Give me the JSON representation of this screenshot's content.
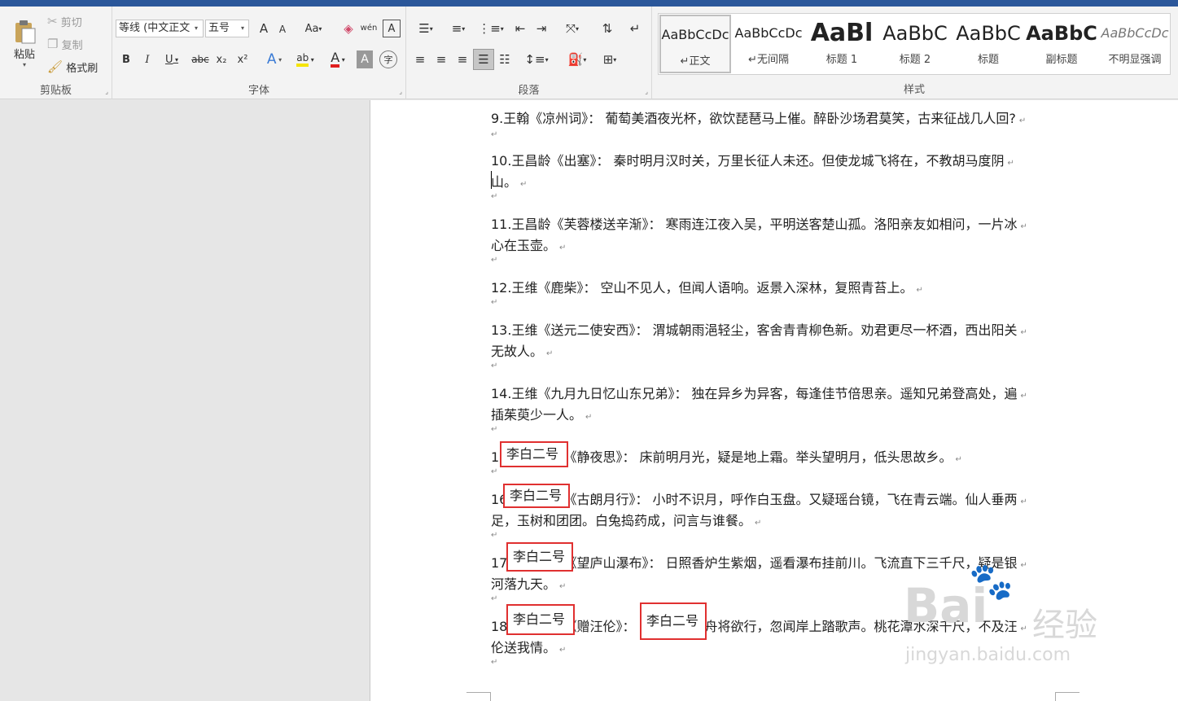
{
  "clipboard": {
    "paste": "粘贴",
    "cut": "剪切",
    "copy": "复制",
    "format_painter": "格式刷",
    "group": "剪贴板"
  },
  "font": {
    "name": "等线 (中文正文",
    "size": "五号",
    "group": "字体",
    "bold": "B",
    "italic": "I",
    "underline": "U",
    "strike": "abc",
    "sub": "x₂",
    "sup": "x²",
    "case": "Aa",
    "grow": "A",
    "shrink": "A",
    "phonetic": "wén",
    "border_char": "A",
    "text_effect": "A",
    "highlight": "ab",
    "color": "A",
    "shade": "A",
    "enclose": "字"
  },
  "paragraph": {
    "group": "段落"
  },
  "styles": {
    "group": "样式",
    "items": [
      {
        "preview": "AaBbCcDc",
        "name": "↵正文",
        "selected": true
      },
      {
        "preview": "AaBbCcDc",
        "name": "↵无间隔"
      },
      {
        "preview": "AaBl",
        "name": "标题 1"
      },
      {
        "preview": "AaBbC",
        "name": "标题 2"
      },
      {
        "preview": "AaBbC",
        "name": "标题"
      },
      {
        "preview": "AaBbC",
        "name": "副标题"
      },
      {
        "preview": "AaBbCcDc",
        "name": "不明显强调"
      }
    ]
  },
  "document": {
    "lines": [
      "9.王翰《凉州词》： 葡萄美酒夜光杯，欲饮琵琶马上催。醉卧沙场君莫笑，古来征战几人回?",
      "10.王昌龄《出塞》： 秦时明月汉时关，万里长征人未还。但使龙城飞将在，不教胡马度阴",
      "山。",
      "11.王昌龄《芙蓉楼送辛渐》： 寒雨连江夜入吴，平明送客楚山孤。洛阳亲友如相问，一片冰",
      "心在玉壶。",
      "12.王维《鹿柴》： 空山不见人，但闻人语响。返景入深林，复照青苔上。",
      "13.王维《送元二使安西》： 渭城朝雨浥轻尘，客舍青青柳色新。劝君更尽一杯酒，西出阳关",
      "无故人。",
      "14.王维《九月九日忆山东兄弟》： 独在异乡为异客，每逢佳节倍思亲。遥知兄弟登高处，遍",
      "插茱萸少一人。",
      "15.李白二号《静夜思》： 床前明月光，疑是地上霜。举头望明月，低头思故乡。",
      "16.李白二号《古朗月行》： 小时不识月，呼作白玉盘。又疑瑶台镜，飞在青云端。仙人垂两",
      "足，玉树和团团。白兔捣药成，问言与谁餐。",
      "17.李白二号《望庐山瀑布》： 日照香炉生紫烟，遥看瀑布挂前川。飞流直下三千尺，疑是银",
      "河落九天。",
      "18.李白二号《赠汪伦》： 李白二号乘舟将欲行，忽闻岸上踏歌声。桃花潭水深千尺，不及汪",
      "伦送我情。"
    ],
    "highlight": "李白二号",
    "para_mark": "↵"
  },
  "watermark": {
    "brand": "Bai",
    "brand2": "经验",
    "url": "jingyan.baidu.com"
  }
}
